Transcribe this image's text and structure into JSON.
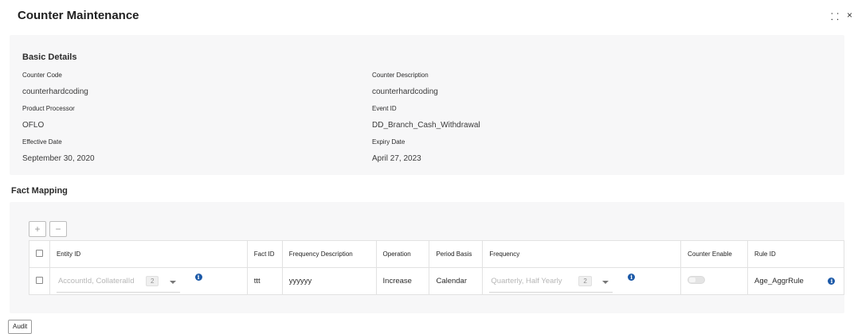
{
  "window": {
    "title": "Counter Maintenance",
    "icons": [
      "expand-icon",
      "close-icon"
    ]
  },
  "basic_details": {
    "title": "Basic Details",
    "fields": {
      "counter_code": {
        "label": "Counter Code",
        "value": "counterhardcoding"
      },
      "counter_description": {
        "label": "Counter Description",
        "value": "counterhardcoding"
      },
      "product_processor": {
        "label": "Product Processor",
        "value": "OFLO"
      },
      "event_id": {
        "label": "Event ID",
        "value": "DD_Branch_Cash_Withdrawal"
      },
      "effective_date": {
        "label": "Effective Date",
        "value": "September 30, 2020"
      },
      "expiry_date": {
        "label": "Expiry Date",
        "value": "April 27, 2023"
      }
    }
  },
  "fact_mapping": {
    "title": "Fact Mapping",
    "add_label": "+",
    "remove_label": "−",
    "columns": {
      "entity_id": "Entity ID",
      "fact_id": "Fact ID",
      "frequency_description": "Frequency Description",
      "operation": "Operation",
      "period_basis": "Period Basis",
      "frequency": "Frequency",
      "counter_enable": "Counter Enable",
      "rule_id": "Rule ID"
    },
    "rows": [
      {
        "entity_id": {
          "placeholder": "AccountId, CollateralId",
          "count": "2"
        },
        "fact_id": "ttt",
        "frequency_description": "yyyyyy",
        "operation": "Increase",
        "period_basis": "Calendar",
        "frequency": {
          "placeholder": "Quarterly, Half Yearly",
          "count": "2"
        },
        "counter_enable": false,
        "rule_id": "Age_AggrRule"
      }
    ],
    "info_glyph": "i"
  },
  "footer": {
    "audit_label": "Audit"
  },
  "colors": {
    "panel_bg": "#f7f7f8",
    "info_blue": "#1d5aa8"
  }
}
